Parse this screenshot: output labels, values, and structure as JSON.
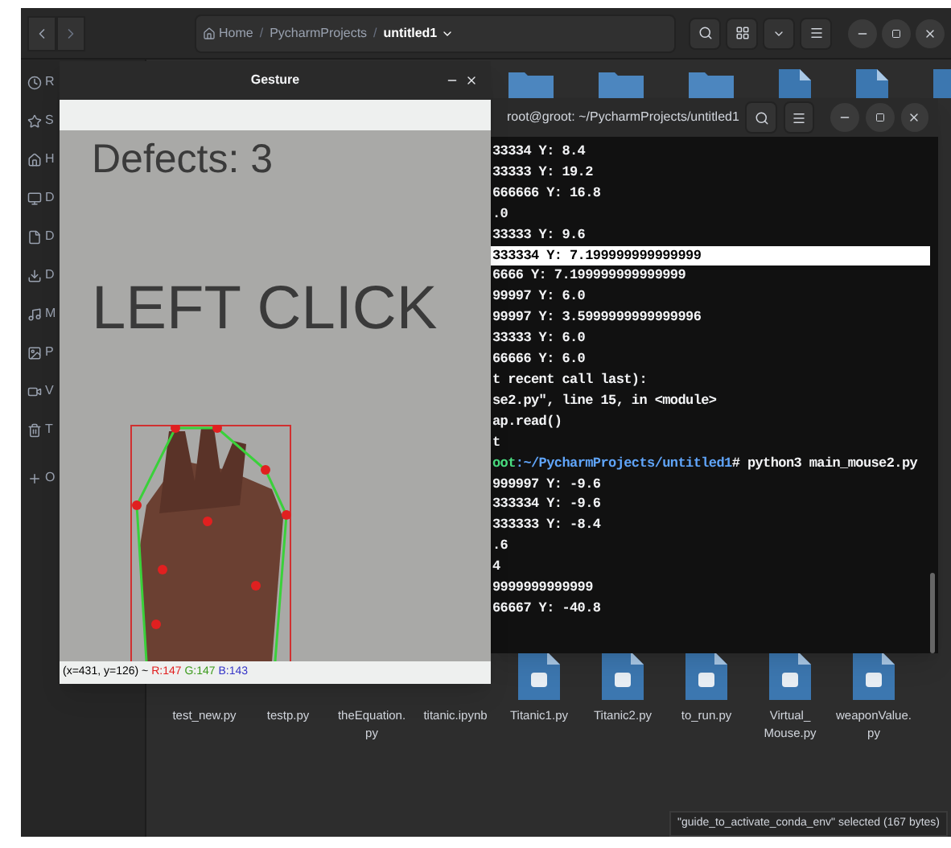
{
  "file_manager": {
    "breadcrumbs": [
      {
        "label": "Home",
        "kind": "home",
        "selected": false
      },
      {
        "label": "PycharmProjects",
        "kind": "folder",
        "selected": false
      },
      {
        "label": "untitled1",
        "kind": "folder",
        "selected": true
      }
    ],
    "breadcrumb_separator": "/",
    "sidebar": [
      {
        "label": "R",
        "kind": "recent"
      },
      {
        "label": "S",
        "kind": "star"
      },
      {
        "label": "H",
        "kind": "home"
      },
      {
        "label": "D",
        "kind": "desktop"
      },
      {
        "label": "D",
        "kind": "document"
      },
      {
        "label": "D",
        "kind": "download"
      },
      {
        "label": "M",
        "kind": "music"
      },
      {
        "label": "P",
        "kind": "picture"
      },
      {
        "label": "V",
        "kind": "video"
      },
      {
        "label": "T",
        "kind": "trash"
      },
      {
        "label": "O",
        "kind": "plus"
      }
    ],
    "top_icons": [
      {
        "kind": "folder"
      },
      {
        "kind": "folder"
      },
      {
        "kind": "folder"
      },
      {
        "kind": "document"
      },
      {
        "kind": "document"
      },
      {
        "kind": "document"
      }
    ],
    "files": [
      {
        "name": "test_new.py"
      },
      {
        "name": "testp.py"
      },
      {
        "name": "theEquation.\npy"
      },
      {
        "name": "titanic.ipynb"
      },
      {
        "name": "Titanic1.py"
      },
      {
        "name": "Titanic2.py"
      },
      {
        "name": "to_run.py"
      },
      {
        "name": "Virtual_\nMouse.py"
      },
      {
        "name": "weaponValue.\npy"
      }
    ],
    "status": "\"guide_to_activate_conda_env\" selected (167 bytes)"
  },
  "gesture_window": {
    "title": "Gesture",
    "defects": "Defects: 3",
    "action": "LEFT CLICK",
    "pixel_info": [
      {
        "text": "(x=431, y=126) ~ ",
        "kind": "plain"
      },
      {
        "text": "R:147",
        "kind": "red"
      },
      {
        "text": " G:147",
        "kind": "green"
      },
      {
        "text": " B:143",
        "kind": "blue"
      }
    ]
  },
  "terminal": {
    "title": "root@groot: ~/PycharmProjects/untitled1",
    "lines": [
      {
        "parts": [
          {
            "text": "33334 Y: 8.4",
            "kind": "text"
          }
        ],
        "selected": false
      },
      {
        "parts": [
          {
            "text": "33333 Y: 19.2",
            "kind": "text"
          }
        ],
        "selected": false
      },
      {
        "parts": [
          {
            "text": "666666 Y: 16.8",
            "kind": "text"
          }
        ],
        "selected": false
      },
      {
        "parts": [
          {
            "text": ".0",
            "kind": "text"
          }
        ],
        "selected": false
      },
      {
        "parts": [
          {
            "text": "33333 Y: 9.6",
            "kind": "text"
          }
        ],
        "selected": false
      },
      {
        "parts": [
          {
            "text": "333334 Y: 7.199999999999999",
            "kind": "text"
          }
        ],
        "selected": true
      },
      {
        "parts": [
          {
            "text": "6666 Y: 7.199999999999999",
            "kind": "text"
          }
        ],
        "selected": false
      },
      {
        "parts": [
          {
            "text": "99997 Y: 6.0",
            "kind": "text"
          }
        ],
        "selected": false
      },
      {
        "parts": [
          {
            "text": "99997 Y: 3.5999999999999996",
            "kind": "text"
          }
        ],
        "selected": false
      },
      {
        "parts": [
          {
            "text": "33333 Y: 6.0",
            "kind": "text"
          }
        ],
        "selected": false
      },
      {
        "parts": [
          {
            "text": "66666 Y: 6.0",
            "kind": "text"
          }
        ],
        "selected": false
      },
      {
        "parts": [
          {
            "text": "t recent call last):",
            "kind": "text"
          }
        ],
        "selected": false
      },
      {
        "parts": [
          {
            "text": "se2.py\", line 15, in <module>",
            "kind": "text"
          }
        ],
        "selected": false
      },
      {
        "parts": [
          {
            "text": "ap.read()",
            "kind": "text"
          }
        ],
        "selected": false
      },
      {
        "parts": [
          {
            "text": "t",
            "kind": "text"
          }
        ],
        "selected": false
      },
      {
        "parts": [
          {
            "text": "oot",
            "kind": "user"
          },
          {
            "text": ":~/PycharmProjects/untitled1",
            "kind": "path"
          },
          {
            "text": "# python3 main_mouse2.py",
            "kind": "text"
          }
        ],
        "selected": false
      },
      {
        "parts": [
          {
            "text": "999997 Y: -9.6",
            "kind": "text"
          }
        ],
        "selected": false
      },
      {
        "parts": [
          {
            "text": "333334 Y: -9.6",
            "kind": "text"
          }
        ],
        "selected": false
      },
      {
        "parts": [
          {
            "text": "333333 Y: -8.4",
            "kind": "text"
          }
        ],
        "selected": false
      },
      {
        "parts": [
          {
            "text": ".6",
            "kind": "text"
          }
        ],
        "selected": false
      },
      {
        "parts": [
          {
            "text": "4",
            "kind": "text"
          }
        ],
        "selected": false
      },
      {
        "parts": [
          {
            "text": "9999999999999",
            "kind": "text"
          }
        ],
        "selected": false
      },
      {
        "parts": [
          {
            "text": "66667 Y: -40.8",
            "kind": "text"
          }
        ],
        "selected": false
      }
    ]
  }
}
